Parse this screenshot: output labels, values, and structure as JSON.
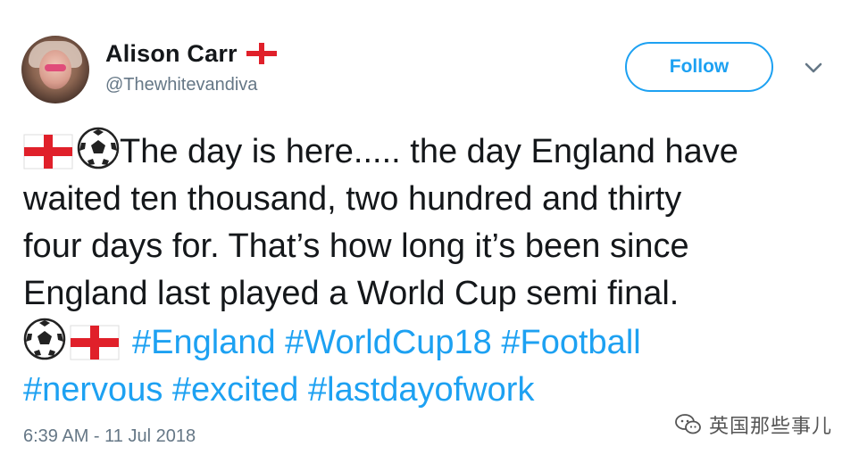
{
  "user": {
    "display_name": "Alison Carr",
    "handle": "@Thewhitevandiva",
    "name_emoji": "england-flag-icon"
  },
  "actions": {
    "follow_label": "Follow",
    "more_icon": "chevron-down-icon"
  },
  "tweet": {
    "line1_text": "The day is here..... the day England have",
    "line2_text": "waited ten thousand, two hundred and thirty",
    "line3_text": "four days for. That’s  how long it’s been since",
    "line4_text": "England last played a World Cup semi final.",
    "hashtags": [
      "#England",
      "#WorldCup18",
      "#Football",
      "#nervous",
      "#excited",
      "#lastdayofwork"
    ]
  },
  "timestamp": "6:39 AM - 11 Jul 2018",
  "watermark": {
    "text": "英国那些事儿",
    "icon": "wechat-icon"
  },
  "colors": {
    "link_blue": "#1da1f2",
    "text_dark": "#14171a",
    "text_muted": "#657786",
    "flag_red": "#e0202a"
  }
}
